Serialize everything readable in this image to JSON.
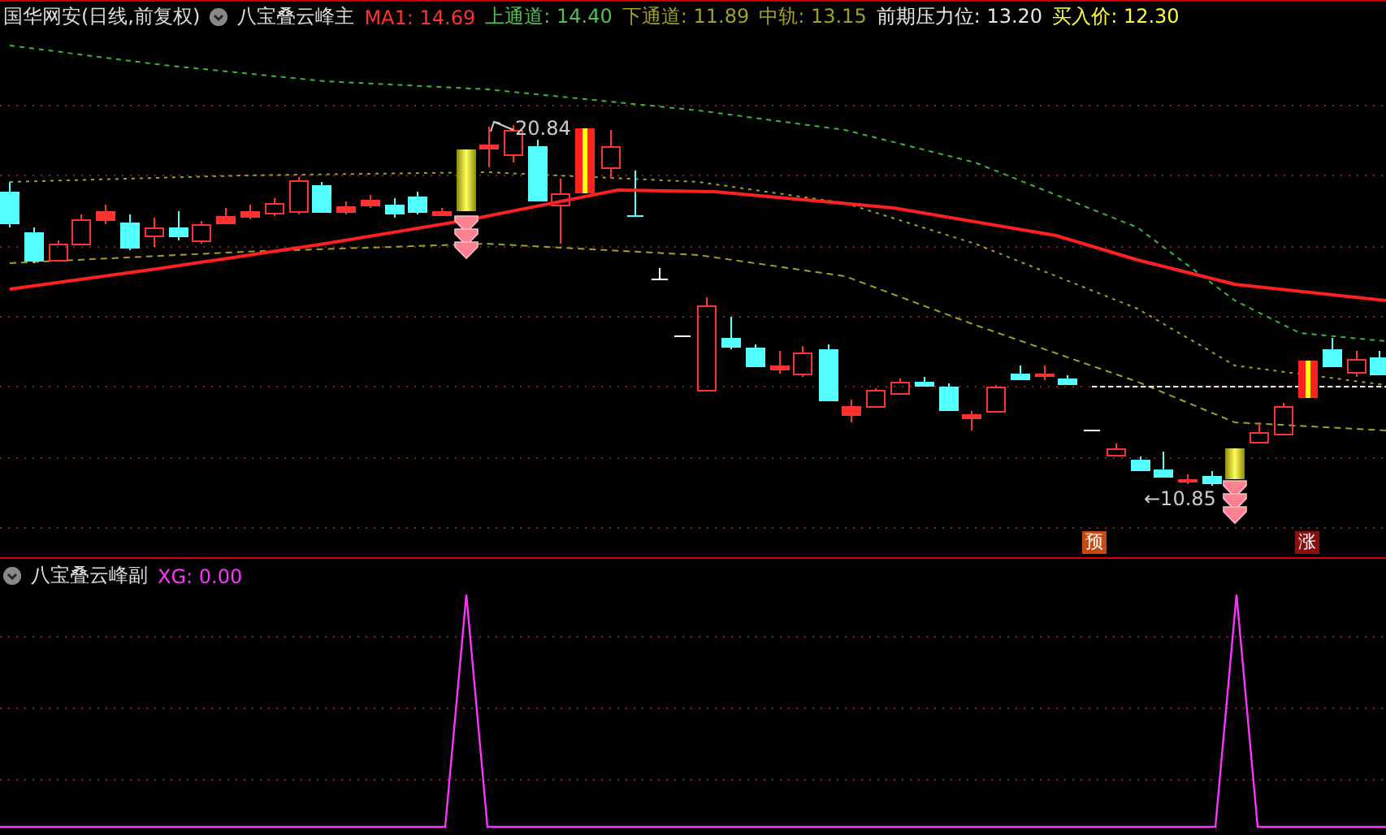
{
  "header": {
    "security": "国华网安(日线,前复权)",
    "indicator": "八宝叠云峰主",
    "values": [
      {
        "label": "MA1:",
        "value": "14.69",
        "color": "#ff3232"
      },
      {
        "label": "上通道:",
        "value": "14.40",
        "color": "#52c052"
      },
      {
        "label": "下通道:",
        "value": "11.89",
        "color": "#a0a028"
      },
      {
        "label": "中轨:",
        "value": "13.15",
        "color": "#a0a028"
      },
      {
        "label": "前期压力位:",
        "value": "13.20",
        "color": "#e8e8e8"
      },
      {
        "label": "买入价:",
        "value": "12.30",
        "color": "#ffff33"
      }
    ]
  },
  "main_chart": {
    "high_label": "20.84",
    "low_label": "←10.85",
    "markers": [
      {
        "text": "预",
        "kind": "forecast"
      },
      {
        "text": "涨",
        "kind": "rise"
      }
    ]
  },
  "sub_chart": {
    "indicator": "八宝叠云峰副",
    "value_label": "XG:",
    "value": "0.00"
  }
}
